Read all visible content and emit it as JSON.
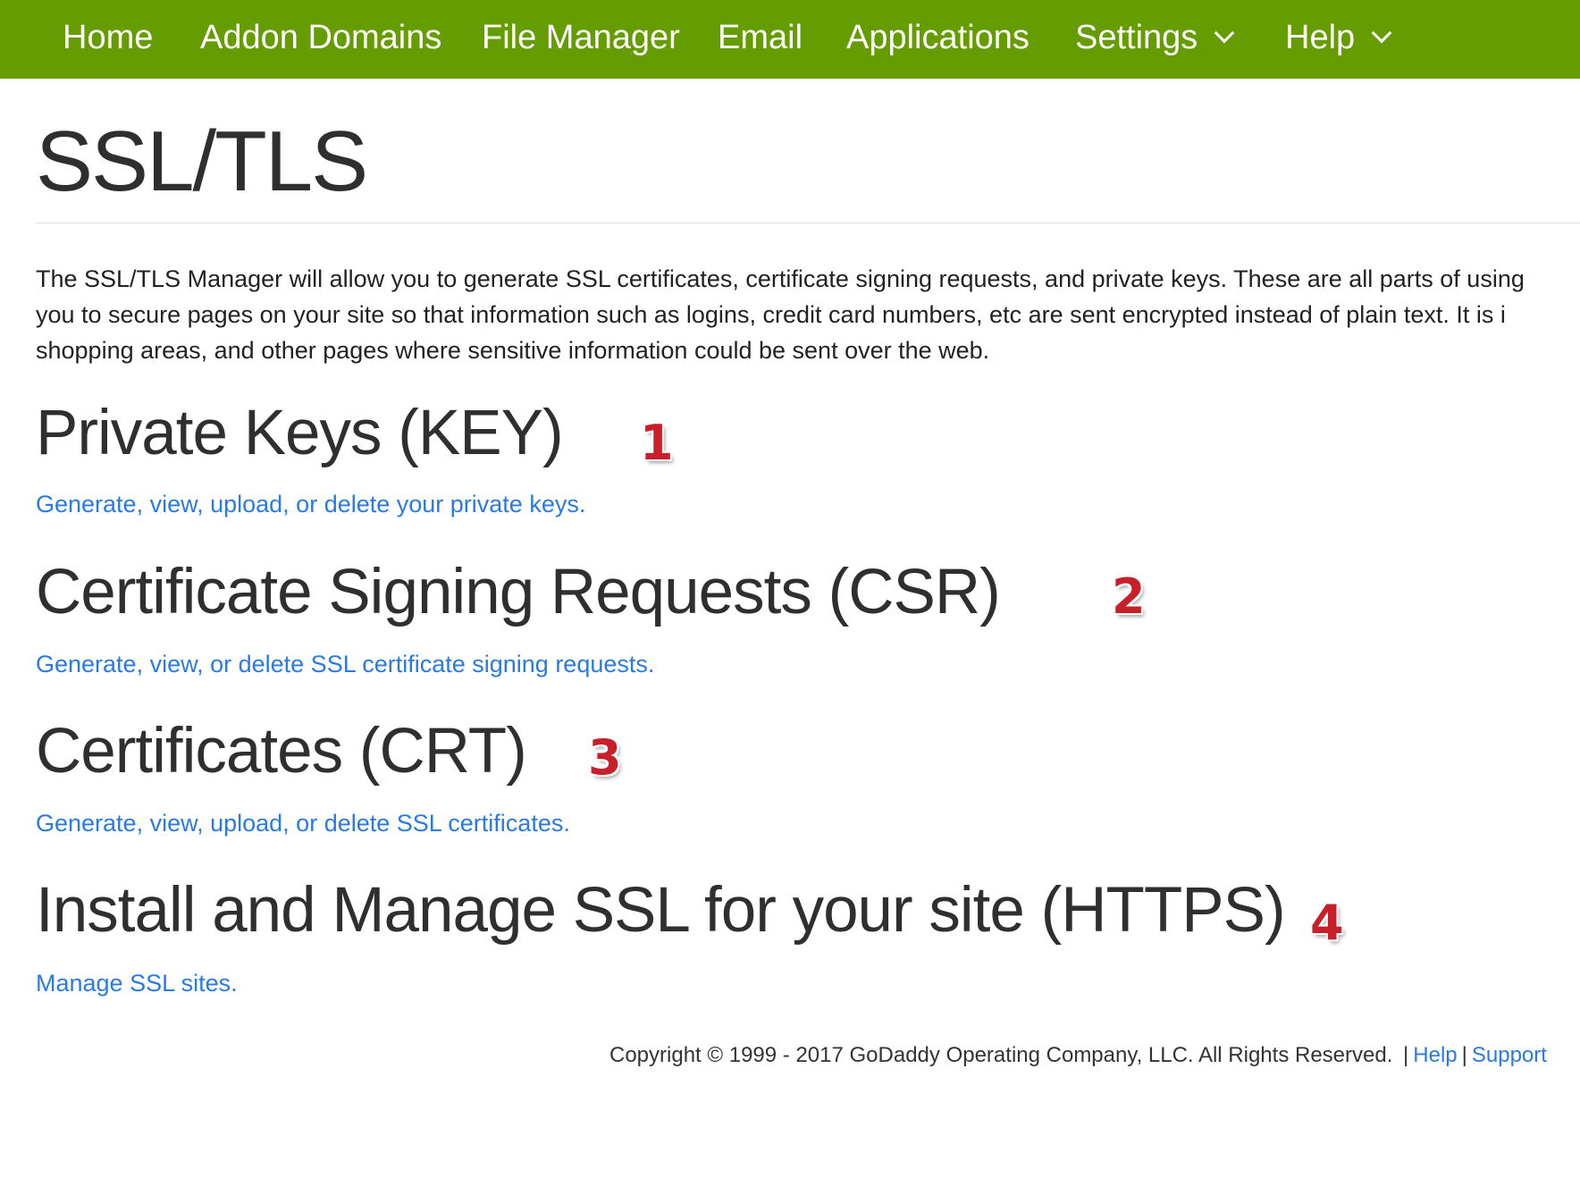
{
  "nav": {
    "items": [
      {
        "label": "Home",
        "has_dropdown": false
      },
      {
        "label": "Addon Domains",
        "has_dropdown": false
      },
      {
        "label": "File Manager",
        "has_dropdown": false
      },
      {
        "label": "Email",
        "has_dropdown": false
      },
      {
        "label": "Applications",
        "has_dropdown": false
      },
      {
        "label": "Settings",
        "has_dropdown": true
      },
      {
        "label": "Help",
        "has_dropdown": true
      }
    ]
  },
  "page": {
    "title": "SSL/TLS",
    "intro_lines": [
      "The SSL/TLS Manager will allow you to generate SSL certificates, certificate signing requests, and private keys. These are all parts of using",
      "you to secure pages on your site so that information such as logins, credit card numbers, etc are sent encrypted instead of plain text. It is i",
      "shopping areas, and other pages where sensitive information could be sent over the web."
    ]
  },
  "sections": [
    {
      "title": "Private Keys (KEY)",
      "link": "Generate, view, upload, or delete your private keys.",
      "badge": "1"
    },
    {
      "title": "Certificate Signing Requests (CSR)",
      "link": "Generate, view, or delete SSL certificate signing requests.",
      "badge": "2"
    },
    {
      "title": "Certificates (CRT)",
      "link": "Generate, view, upload, or delete SSL certificates.",
      "badge": "3"
    },
    {
      "title": "Install and Manage SSL for your site (HTTPS)",
      "link": "Manage SSL sites.",
      "badge": "4"
    }
  ],
  "footer": {
    "copyright": "Copyright © 1999 - 2017 GoDaddy Operating Company, LLC. All Rights Reserved.",
    "separator": "|",
    "help_link": "Help",
    "support_link": "Support"
  },
  "colors": {
    "nav_background": "#659c00",
    "link": "#2a7ae2",
    "badge": "#c8202a"
  }
}
